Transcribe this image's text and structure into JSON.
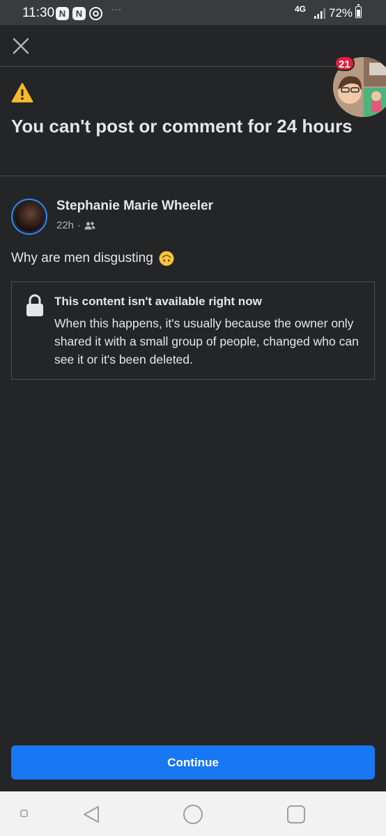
{
  "status_bar": {
    "time": "11:30",
    "notification_icons": [
      "N",
      "N"
    ],
    "more_indicator": "···",
    "network": "4G",
    "battery": "72%"
  },
  "chat_head": {
    "badge_count": "21"
  },
  "restriction": {
    "headline": "You can't post or comment for 24 hours"
  },
  "post": {
    "author": "Stephanie Marie Wheeler",
    "time": "22h",
    "separator": "·",
    "text": "Why are men disgusting"
  },
  "unavailable": {
    "title": "This content isn't available right now",
    "body": "When this happens, it's usually because the owner only shared it with a small group of people, changed who can see it or it's been deleted."
  },
  "footer": {
    "continue_label": "Continue"
  },
  "colors": {
    "background": "#242526",
    "accent": "#1877f2",
    "badge": "#e41e3f",
    "warning": "#f7b928"
  }
}
